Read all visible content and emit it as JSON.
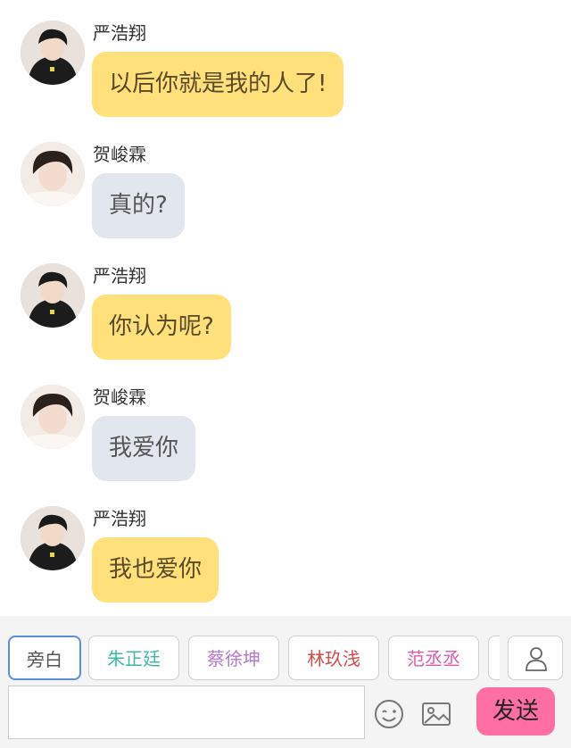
{
  "messages": [
    {
      "sender": "严浩翔",
      "text": "以后你就是我的人了!",
      "style": "yellow"
    },
    {
      "sender": "贺峻霖",
      "text": "真的?",
      "style": "grey"
    },
    {
      "sender": "严浩翔",
      "text": "你认为呢?",
      "style": "yellow"
    },
    {
      "sender": "贺峻霖",
      "text": "我爱你",
      "style": "grey"
    },
    {
      "sender": "严浩翔",
      "text": "我也爱你",
      "style": "yellow"
    }
  ],
  "roles": [
    {
      "label": "旁白",
      "color": "#555555"
    },
    {
      "label": "朱正廷",
      "color": "#3fb8a8"
    },
    {
      "label": "蔡徐坤",
      "color": "#b07ad0"
    },
    {
      "label": "林玖浅",
      "color": "#d64a4a"
    },
    {
      "label": "范丞丞",
      "color": "#e05aa8"
    }
  ],
  "input": {
    "value": ""
  },
  "send_label": "发送",
  "icons": {
    "emoji": "smile-icon",
    "image": "image-icon",
    "person": "person-icon"
  },
  "colors": {
    "yellow_bubble": "#ffe07a",
    "grey_bubble": "#e2e6ee",
    "send": "#ff6fa4",
    "active_border": "#5b8fd6"
  }
}
